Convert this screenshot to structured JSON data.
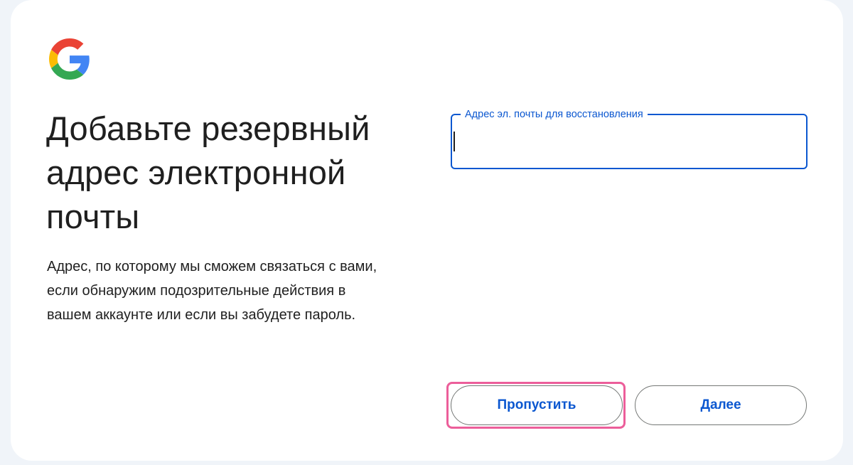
{
  "logo": {
    "icon": "google-g-icon",
    "colors": [
      "#ea4335",
      "#fbbc05",
      "#34a853",
      "#4285f4"
    ]
  },
  "heading": "Добавьте резервный адрес электронной почты",
  "description": "Адрес, по которому мы сможем связаться с вами, если обнаружим подозрительные действия в вашем аккаунте или если вы забудете пароль.",
  "recovery_email": {
    "label": "Адрес эл. почты для восстановления",
    "value": ""
  },
  "buttons": {
    "skip_label": "Пропустить",
    "next_label": "Далее"
  },
  "colors": {
    "accent": "#0b57d0",
    "highlight": "#ec5e9a",
    "text": "#1f1f1f"
  }
}
